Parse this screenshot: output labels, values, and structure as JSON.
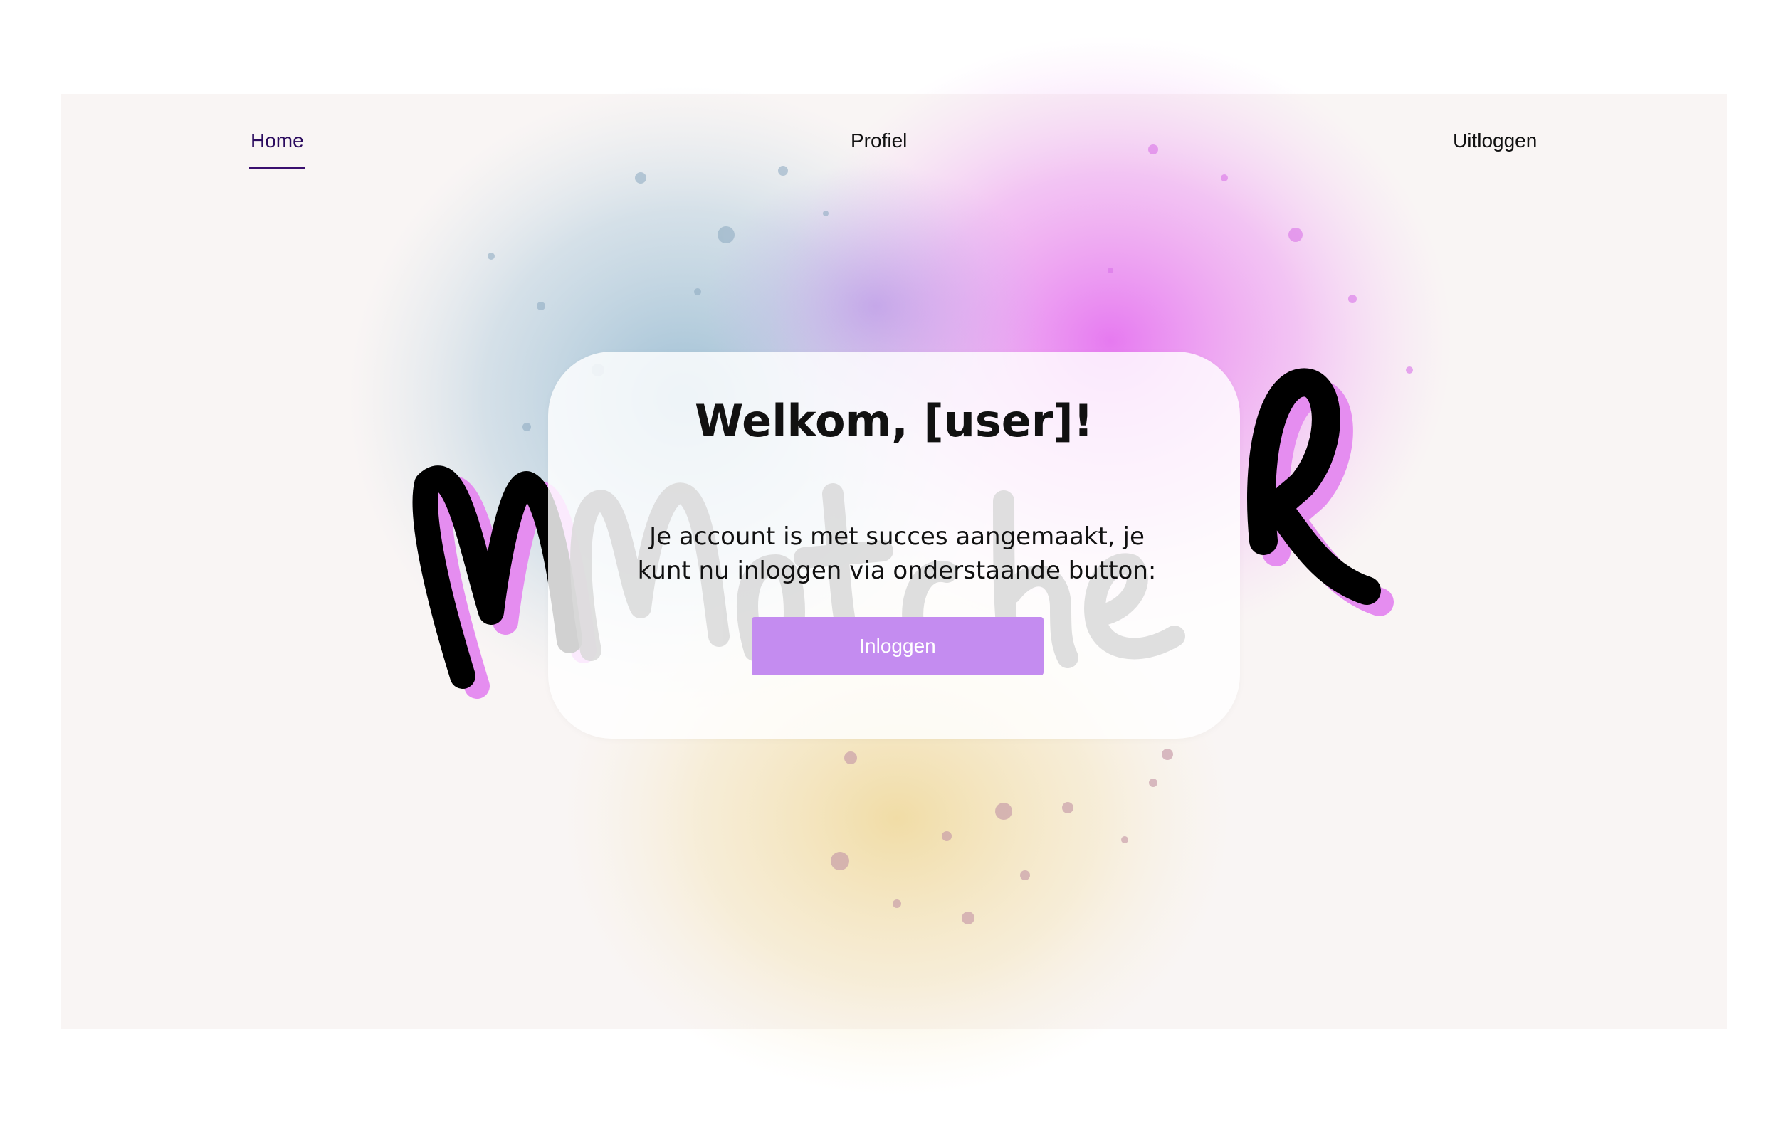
{
  "nav": {
    "items": [
      {
        "label": "Home",
        "active": true
      },
      {
        "label": "Profiel",
        "active": false
      },
      {
        "label": "Uitloggen",
        "active": false
      }
    ]
  },
  "logo": {
    "text": "Matcher"
  },
  "card": {
    "title": "Welkom, [user]!",
    "message": "Je account is met succes aangemaakt, je kunt nu inloggen via onderstaande button:",
    "button_label": "Inloggen"
  },
  "colors": {
    "active_nav": "#2b0b5e",
    "button": "#c48cf0",
    "background_panel": "#f9f5f4",
    "splash_blue": "#9fc0d6",
    "splash_pink": "#e87cf0",
    "splash_yellow": "#f0d890"
  }
}
